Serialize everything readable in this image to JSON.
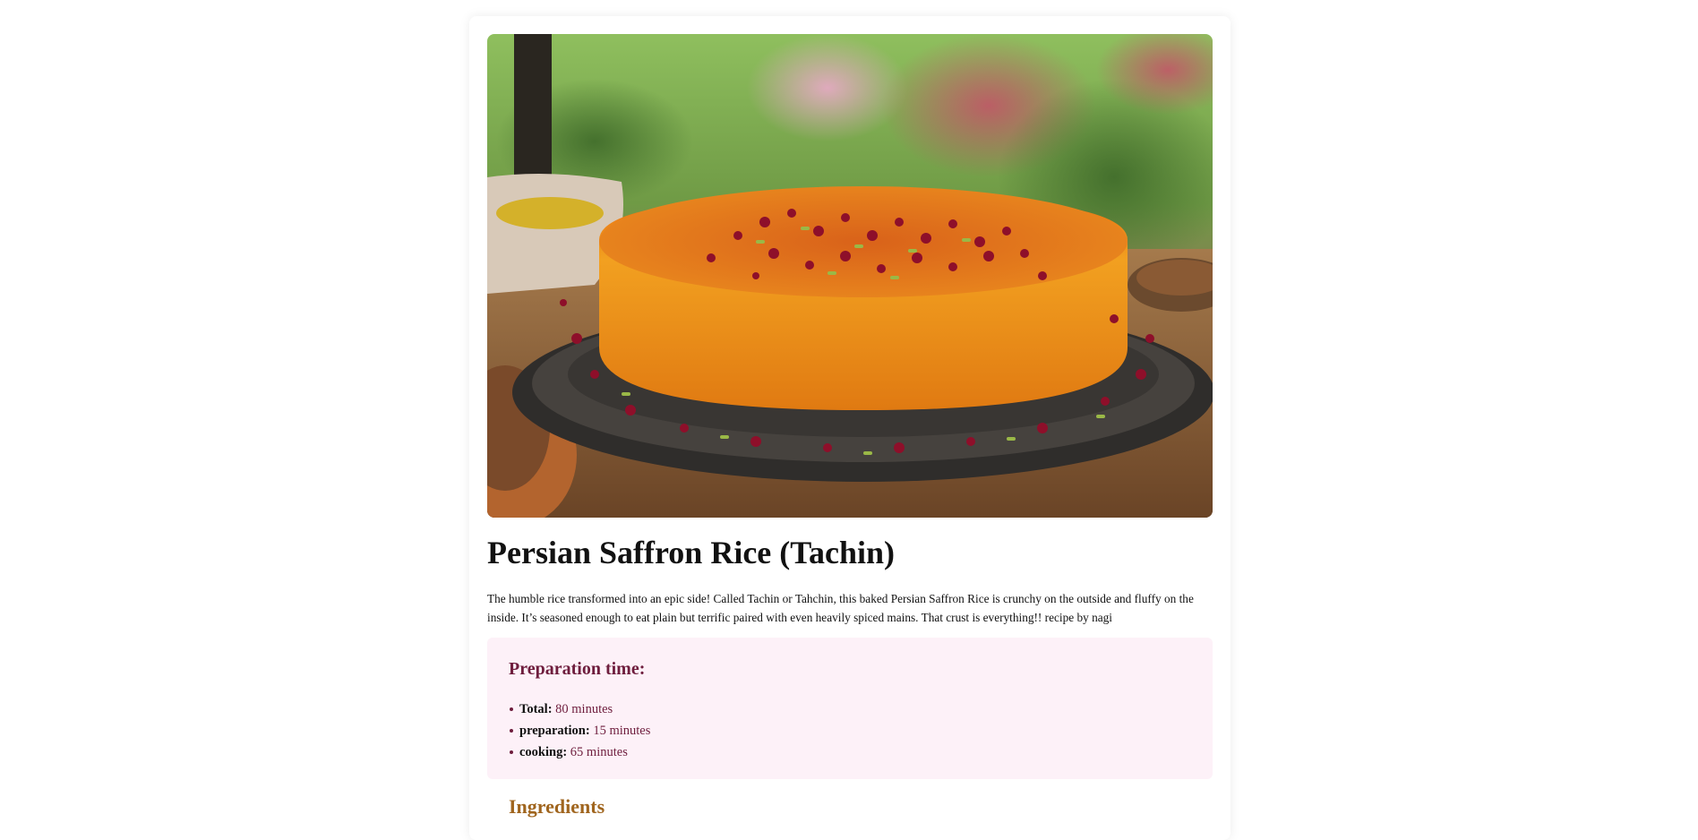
{
  "recipe": {
    "title": "Persian Saffron Rice (Tachin)",
    "description": "The humble rice transformed into an epic side! Called Tachin or Tahchin, this baked Persian Saffron Rice is crunchy on the outside and fluffy on the inside. It’s seasoned enough to eat plain but terrific paired with even heavily spiced mains. That crust is everything!! recipe by nagi"
  },
  "prep": {
    "heading": "Preparation time:",
    "items": [
      {
        "label": "Total:",
        "value": "80 minutes"
      },
      {
        "label": "preparation:",
        "value": "15 minutes"
      },
      {
        "label": "cooking:",
        "value": "65 minutes"
      }
    ]
  },
  "ingredients": {
    "heading": "Ingredients"
  },
  "colors": {
    "prep_bg": "#fdf1f8",
    "prep_text": "#6e1d3d",
    "ingredients_heading": "#a0651e"
  }
}
